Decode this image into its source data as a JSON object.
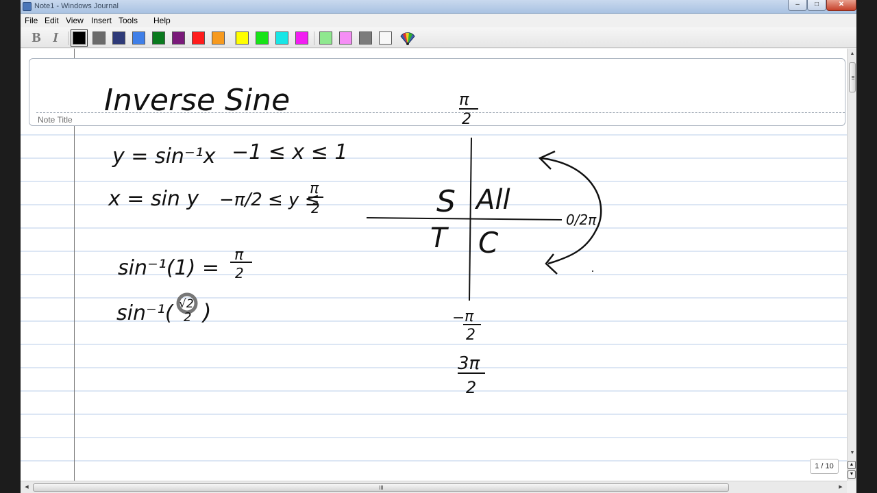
{
  "window": {
    "title": "Note1 - Windows Journal",
    "minimize_glyph": "–",
    "maximize_glyph": "□",
    "close_glyph": "✕"
  },
  "menu": [
    "File",
    "Edit",
    "View",
    "Insert",
    "Tools",
    "Help"
  ],
  "toolbar": {
    "bold_label": "B",
    "italic_label": "I",
    "pen_colors": [
      {
        "name": "black",
        "hex": "#000000",
        "selected": true
      },
      {
        "name": "gray",
        "hex": "#6a6a6a"
      },
      {
        "name": "navy",
        "hex": "#2e3a78"
      },
      {
        "name": "blue",
        "hex": "#3f7fe8"
      },
      {
        "name": "green",
        "hex": "#0a7a1e"
      },
      {
        "name": "purple",
        "hex": "#7a1a7a"
      },
      {
        "name": "red",
        "hex": "#ff1c1c"
      },
      {
        "name": "orange",
        "hex": "#f79a1e"
      },
      {
        "name": "yellow",
        "hex": "#ffff00"
      },
      {
        "name": "bright-green",
        "hex": "#18e318"
      },
      {
        "name": "cyan",
        "hex": "#18e6e6"
      },
      {
        "name": "magenta",
        "hex": "#f21ef2"
      },
      {
        "name": "light-green",
        "hex": "#8fe88f"
      },
      {
        "name": "pink",
        "hex": "#f58ef5"
      },
      {
        "name": "dark-gray",
        "hex": "#7c7c7c"
      },
      {
        "name": "white",
        "hex": "#f8f8f8"
      }
    ],
    "pen_icon": "pen-palette-icon"
  },
  "note": {
    "title_label": "Note Title",
    "handwriting": {
      "title": "Inverse Sine",
      "line1": "y = sin⁻¹x",
      "line1_domain": "−1 ≤ x ≤ 1",
      "line2": "x = sin y",
      "line2_range_left": "−π/2 ≤ y ≤",
      "line3_left": "sin⁻¹(1) =",
      "line4_left": "sin⁻¹(",
      "line4_num": "√2",
      "line4_den": "2",
      "line4_right": ")",
      "pi": "π",
      "two": "2",
      "minus": "−",
      "three_pi": "3π",
      "quad_s": "S",
      "quad_all": "All",
      "quad_t": "T",
      "quad_c": "C",
      "zero_two_pi": "0/2π"
    }
  },
  "status": {
    "page_indicator": "1 / 10",
    "page_up_glyph": "▲",
    "page_down_glyph": "▼"
  },
  "scroll": {
    "up_glyph": "▲",
    "down_glyph": "▼",
    "left_glyph": "◀",
    "right_glyph": "▶"
  }
}
